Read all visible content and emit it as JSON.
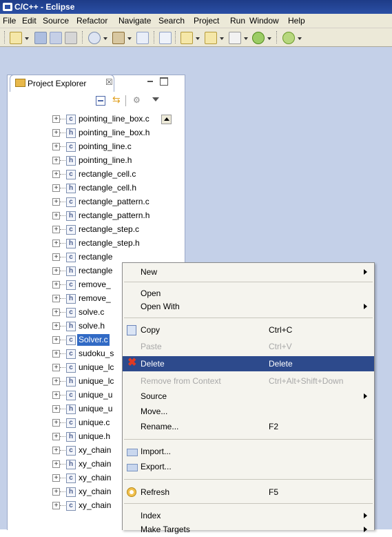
{
  "window": {
    "title": "C/C++ - Eclipse"
  },
  "menubar": [
    "File",
    "Edit",
    "Source",
    "Refactor",
    "Navigate",
    "Search",
    "Project",
    "Run",
    "Window",
    "Help"
  ],
  "project_explorer": {
    "tab_label": "Project Explorer",
    "close_glyph": "☒"
  },
  "tree": [
    {
      "type": "c",
      "name": "pointing_line_box.c"
    },
    {
      "type": "h",
      "name": "pointing_line_box.h"
    },
    {
      "type": "c",
      "name": "pointing_line.c"
    },
    {
      "type": "h",
      "name": "pointing_line.h"
    },
    {
      "type": "c",
      "name": "rectangle_cell.c"
    },
    {
      "type": "h",
      "name": "rectangle_cell.h"
    },
    {
      "type": "c",
      "name": "rectangle_pattern.c"
    },
    {
      "type": "h",
      "name": "rectangle_pattern.h"
    },
    {
      "type": "c",
      "name": "rectangle_step.c"
    },
    {
      "type": "h",
      "name": "rectangle_step.h"
    },
    {
      "type": "c",
      "name": "rectangle"
    },
    {
      "type": "h",
      "name": "rectangle"
    },
    {
      "type": "c",
      "name": "remove_"
    },
    {
      "type": "h",
      "name": "remove_"
    },
    {
      "type": "c",
      "name": "solve.c"
    },
    {
      "type": "h",
      "name": "solve.h"
    },
    {
      "type": "c",
      "name": "Solver.c",
      "selected": true
    },
    {
      "type": "c",
      "name": "sudoku_s"
    },
    {
      "type": "c",
      "name": "unique_lc"
    },
    {
      "type": "h",
      "name": "unique_lc"
    },
    {
      "type": "c",
      "name": "unique_u"
    },
    {
      "type": "h",
      "name": "unique_u"
    },
    {
      "type": "c",
      "name": "unique.c"
    },
    {
      "type": "h",
      "name": "unique.h"
    },
    {
      "type": "c",
      "name": "xy_chain"
    },
    {
      "type": "h",
      "name": "xy_chain"
    },
    {
      "type": "c",
      "name": "xy_chain"
    },
    {
      "type": "h",
      "name": "xy_chain"
    },
    {
      "type": "c",
      "name": "xy_chain"
    }
  ],
  "context_menu": {
    "new": {
      "label": "New"
    },
    "open": {
      "label": "Open"
    },
    "open_with": {
      "label": "Open With"
    },
    "copy": {
      "label": "Copy",
      "accel": "Ctrl+C"
    },
    "paste": {
      "label": "Paste",
      "accel": "Ctrl+V"
    },
    "delete": {
      "label": "Delete",
      "accel": "Delete"
    },
    "remove_from_context": {
      "label": "Remove from Context",
      "accel": "Ctrl+Alt+Shift+Down"
    },
    "source": {
      "label": "Source"
    },
    "move": {
      "label": "Move..."
    },
    "rename": {
      "label": "Rename...",
      "accel": "F2"
    },
    "import": {
      "label": "Import..."
    },
    "export": {
      "label": "Export..."
    },
    "refresh": {
      "label": "Refresh",
      "accel": "F5"
    },
    "index": {
      "label": "Index"
    },
    "make_targets": {
      "label": "Make Targets"
    }
  }
}
